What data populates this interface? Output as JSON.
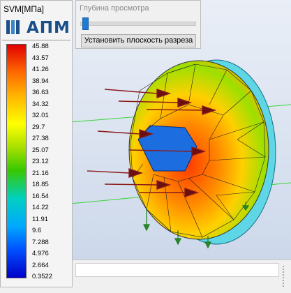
{
  "legend": {
    "title": "SVM[МПа]",
    "logo_text": "АПМ",
    "ticks": [
      "45.88",
      "43.57",
      "41.26",
      "38.94",
      "36.63",
      "34.32",
      "32.01",
      "29.7",
      "27.38",
      "25.07",
      "23.12",
      "21.16",
      "18.85",
      "16.54",
      "14.22",
      "11.91",
      "9.6",
      "7.288",
      "4.976",
      "2.664",
      "0.3522"
    ]
  },
  "depth_panel": {
    "label": "Глубина просмотра",
    "slider_value": 0.02,
    "button_label": "Установить плоскость разреза"
  },
  "colors": {
    "legend_max": "#e10000",
    "legend_min": "#0000c8",
    "arrow": "#8b1a1a",
    "support": "#1f7a1f"
  }
}
